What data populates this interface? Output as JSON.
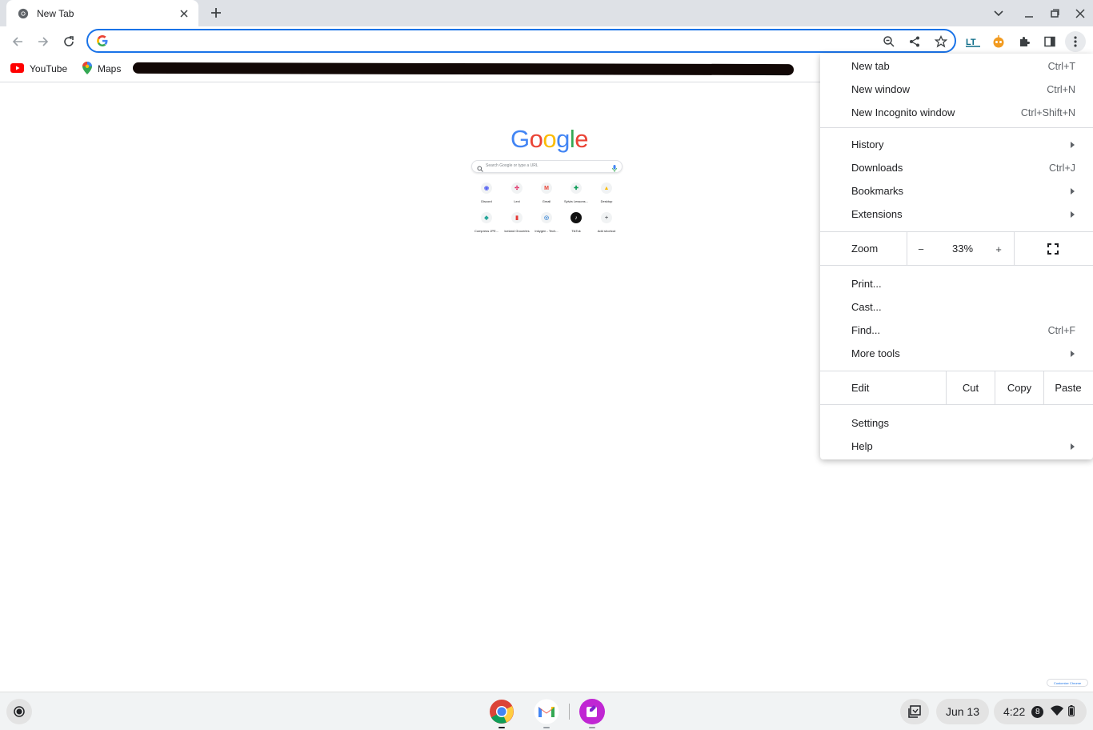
{
  "tab": {
    "title": "New Tab"
  },
  "omnibox": {
    "value": "",
    "placeholder": ""
  },
  "bookmarks": [
    {
      "label": "YouTube",
      "icon": "youtube-icon"
    },
    {
      "label": "Maps",
      "icon": "maps-icon"
    }
  ],
  "ntp": {
    "logo": [
      "G",
      "o",
      "o",
      "g",
      "l",
      "e"
    ],
    "search_placeholder": "Search Google or type a URL",
    "shortcuts": [
      {
        "label": "Discord",
        "glyph": "◉",
        "color": "#5865f2"
      },
      {
        "label": "Lexi",
        "glyph": "✣",
        "color": "#e01e5a"
      },
      {
        "label": "Gmail",
        "glyph": "M",
        "color": "#ea4335"
      },
      {
        "label": "Sylvia Lessons...",
        "glyph": "✚",
        "color": "#0f9d58"
      },
      {
        "label": "Desktop",
        "glyph": "▲",
        "color": "#fbbc04"
      },
      {
        "label": "Compress JPE...",
        "glyph": "◆",
        "color": "#26a69a"
      },
      {
        "label": "Iceland Groceries",
        "glyph": "▮",
        "color": "#e53935"
      },
      {
        "label": "Inkygen - Tech...",
        "glyph": "◎",
        "color": "#4a90d9"
      },
      {
        "label": "TikTok",
        "glyph": "♪",
        "color": "#000000"
      },
      {
        "label": "Add shortcut",
        "glyph": "+",
        "color": "#5f6368"
      }
    ],
    "customize": "Customize Chrome"
  },
  "menu": {
    "new_tab": {
      "label": "New tab",
      "shortcut": "Ctrl+T"
    },
    "new_window": {
      "label": "New window",
      "shortcut": "Ctrl+N"
    },
    "new_incognito": {
      "label": "New Incognito window",
      "shortcut": "Ctrl+Shift+N"
    },
    "history": {
      "label": "History"
    },
    "downloads": {
      "label": "Downloads",
      "shortcut": "Ctrl+J"
    },
    "bookmarks": {
      "label": "Bookmarks"
    },
    "extensions": {
      "label": "Extensions"
    },
    "zoom": {
      "label": "Zoom",
      "minus": "−",
      "value": "33%",
      "plus": "+"
    },
    "print": {
      "label": "Print..."
    },
    "cast": {
      "label": "Cast..."
    },
    "find": {
      "label": "Find...",
      "shortcut": "Ctrl+F"
    },
    "more_tools": {
      "label": "More tools"
    },
    "edit": {
      "label": "Edit",
      "cut": "Cut",
      "copy": "Copy",
      "paste": "Paste"
    },
    "settings": {
      "label": "Settings"
    },
    "help": {
      "label": "Help"
    }
  },
  "shelf": {
    "date": "Jun 13",
    "time": "4:22",
    "notifications": "8"
  },
  "colors": {
    "accent": "#1a73e8",
    "tabstrip": "#dee1e6",
    "shelf": "#f1f3f4"
  }
}
